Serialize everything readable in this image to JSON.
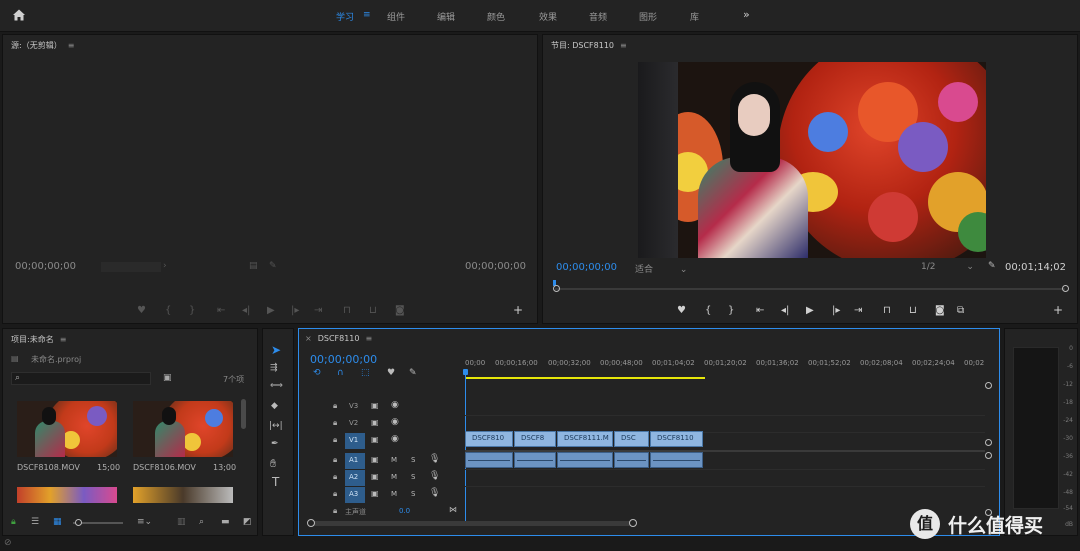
{
  "topbar": {
    "tabs": [
      "学习",
      "组件",
      "编辑",
      "颜色",
      "效果",
      "音频",
      "图形",
      "库"
    ],
    "active_tab": "学习",
    "more": "»"
  },
  "source_monitor": {
    "title": "源:（无剪辑）",
    "timecode_in": "00;00;00;00",
    "timecode_out": "00;00;00;00"
  },
  "program_monitor": {
    "title": "节目: DSCF8110",
    "timecode": "00;00;00;00",
    "fit": "适合",
    "resolution": "1/2",
    "duration": "00;01;14;02"
  },
  "project": {
    "title": "项目:未命名",
    "file": "未命名.prproj",
    "item_count": "7个项",
    "items": [
      {
        "name": "DSCF8108.MOV",
        "duration": "15;00"
      },
      {
        "name": "DSCF8106.MOV",
        "duration": "13;00"
      }
    ]
  },
  "timeline": {
    "sequence_name": "DSCF8110",
    "timecode": "00;00;00;00",
    "ruler": [
      "00;00",
      "00;00;16;00",
      "00;00;32;00",
      "00;00;48;00",
      "00;01;04;02",
      "00;01;20;02",
      "00;01;36;02",
      "00;01;52;02",
      "00;02;08;04",
      "00;02;24;04",
      "00;02"
    ],
    "video_tracks": [
      "V3",
      "V2",
      "V1"
    ],
    "audio_tracks": [
      "A1",
      "A2",
      "A3"
    ],
    "master": "主声道",
    "master_value": "0.0",
    "video_clips": [
      "DSCF810",
      "DSCF8",
      "DSCF8111.M",
      "DSC",
      "DSCF8110"
    ]
  },
  "meter": {
    "ticks": [
      "0",
      "-6",
      "-12",
      "-18",
      "-24",
      "-30",
      "-36",
      "-42",
      "-48",
      "-54",
      "dB"
    ]
  },
  "watermark": {
    "text": "什么值得买",
    "logo": "值"
  }
}
